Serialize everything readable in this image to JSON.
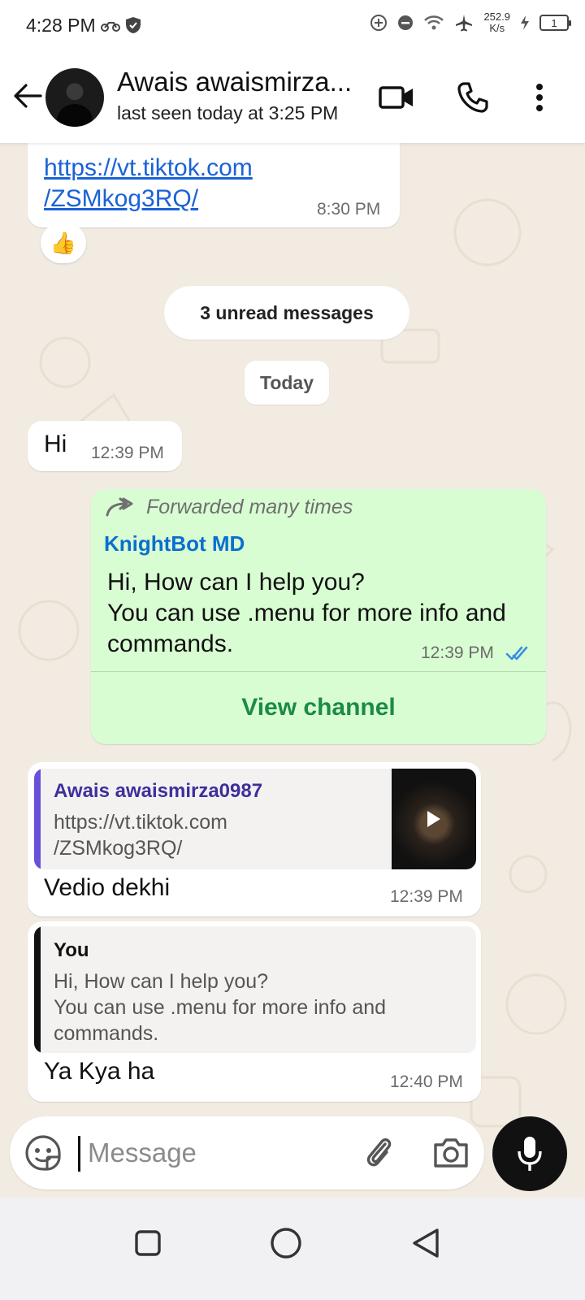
{
  "status_bar": {
    "time": "4:28 PM",
    "speed_value": "252.9",
    "speed_unit": "K/s",
    "battery": "1"
  },
  "header": {
    "contact_name": "Awais awaismirza...",
    "last_seen": "last seen today at 3:25 PM"
  },
  "chat": {
    "prev_message": {
      "link_line1": "https://vt.tiktok.com",
      "link_line2": "/ZSMkog3RQ/",
      "time": "8:30 PM",
      "reaction": "👍"
    },
    "unread_label": "3 unread messages",
    "date_label": "Today",
    "messages": [
      {
        "text": "Hi",
        "time": "12:39 PM"
      },
      {
        "forwarded_label": "Forwarded many times",
        "sender": "KnightBot MD",
        "line1": "Hi, How can I help you?",
        "line2": "You can use .menu for more info and",
        "line3": "commands.",
        "time": "12:39 PM",
        "action": "View channel"
      },
      {
        "quote_name": "Awais awaismirza0987",
        "quote_line1": "https://vt.tiktok.com",
        "quote_line2": "/ZSMkog3RQ/",
        "text": "Vedio dekhi",
        "time": "12:39 PM"
      },
      {
        "quote_name": "You",
        "quote_line1": "Hi, How can I help you?",
        "quote_line2": "You can use .menu for more info and",
        "quote_line3": "commands.",
        "text": "Ya Kya ha",
        "time": "12:40 PM"
      }
    ]
  },
  "composer": {
    "placeholder": "Message"
  },
  "colors": {
    "outgoing_bubble": "#d9fdd3",
    "link": "#1a62d6",
    "sender_name": "#0a6fd1",
    "channel_action": "#1b8a4a",
    "quote_bar_contact": "#6c4fd8",
    "quote_bar_you": "#111111",
    "read_ticks": "#3b8fe0"
  },
  "icons": [
    "back-arrow-icon",
    "video-call-icon",
    "voice-call-icon",
    "more-options-icon",
    "forward-icon",
    "double-check-icon",
    "sticker-icon",
    "attach-icon",
    "camera-icon",
    "mic-icon",
    "nav-recents-icon",
    "nav-home-icon",
    "nav-back-icon"
  ]
}
